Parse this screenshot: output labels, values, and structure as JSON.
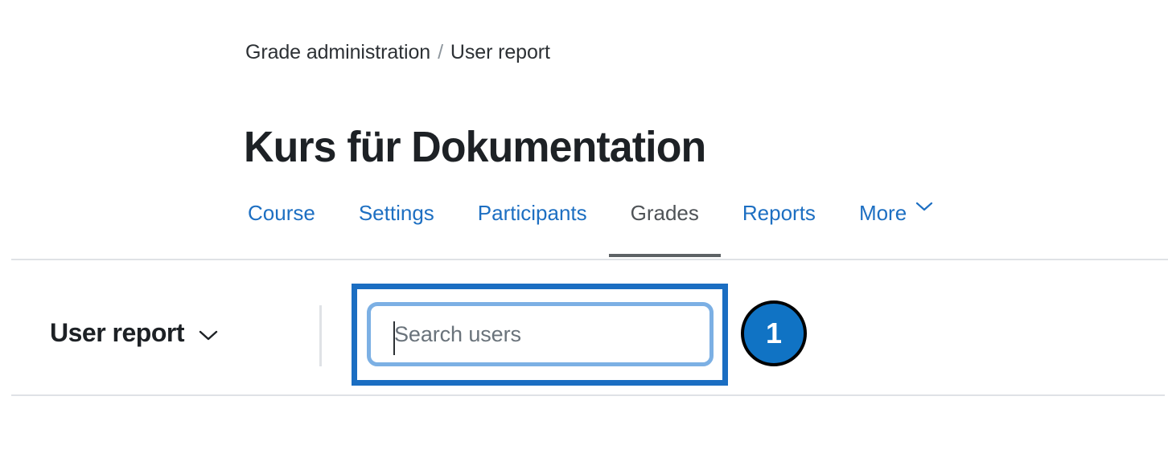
{
  "breadcrumb": {
    "items": [
      "Grade administration",
      "User report"
    ],
    "separator": "/"
  },
  "header": {
    "title": "Kurs für Dokumentation"
  },
  "nav": {
    "tabs": [
      {
        "label": "Course",
        "active": false
      },
      {
        "label": "Settings",
        "active": false
      },
      {
        "label": "Participants",
        "active": false
      },
      {
        "label": "Grades",
        "active": true
      },
      {
        "label": "Reports",
        "active": false
      },
      {
        "label": "More",
        "active": false,
        "icon": "chevron-down-icon"
      }
    ]
  },
  "report_bar": {
    "report_selector_label": "User report",
    "report_selector_icon": "chevron-down-icon",
    "search": {
      "placeholder": "Search users",
      "value": ""
    },
    "step_badge": {
      "number": "1"
    }
  },
  "colors": {
    "link_blue": "#1d6fc2",
    "annotation_blue": "#1b6ec2",
    "focus_ring_blue": "#7cb0e4",
    "badge_blue": "#1073c4",
    "badge_ring": "#000000",
    "active_tab_underline": "#5d6265",
    "divider": "#dfe2e6",
    "text_dark": "#1d2125",
    "placeholder_gray": "#6a737b"
  }
}
